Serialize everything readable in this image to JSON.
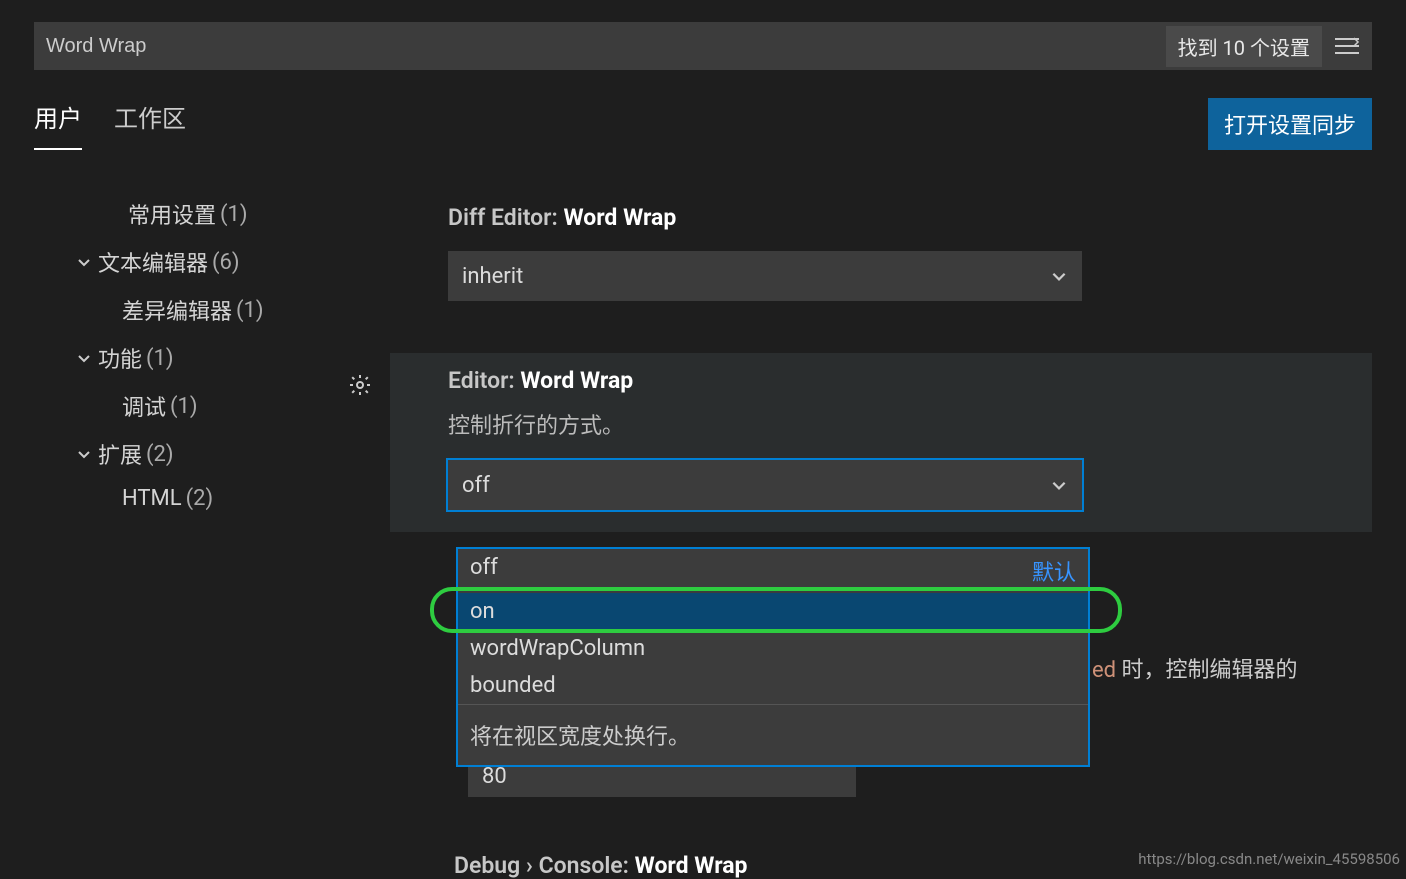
{
  "search": {
    "value": "Word Wrap",
    "result_count": "找到 10 个设置"
  },
  "tabs": {
    "user": "用户",
    "workspace": "工作区"
  },
  "sync_button": "打开设置同步",
  "sidebar": {
    "common": {
      "label": "常用设置",
      "count": "(1)"
    },
    "text_editor": {
      "label": "文本编辑器",
      "count": "(6)"
    },
    "diff_editor": {
      "label": "差异编辑器",
      "count": "(1)"
    },
    "features": {
      "label": "功能",
      "count": "(1)"
    },
    "debug": {
      "label": "调试",
      "count": "(1)"
    },
    "extensions": {
      "label": "扩展",
      "count": "(2)"
    },
    "html": {
      "label": "HTML",
      "count": "(2)"
    }
  },
  "setting1": {
    "ns": "Diff Editor: ",
    "name": "Word Wrap",
    "value": "inherit"
  },
  "setting2": {
    "ns": "Editor: ",
    "name": "Word Wrap",
    "desc": "控制折行的方式。",
    "value": "off",
    "options": {
      "off": "off",
      "on": "on",
      "wordWrapColumn": "wordWrapColumn",
      "bounded": "bounded"
    },
    "default_tag": "默认",
    "hint": "将在视区宽度处换行。"
  },
  "behind": {
    "suffix": " 时，控制编辑器的",
    "bounded_fragment": "ed",
    "column_value": "80"
  },
  "setting3": {
    "ns": "Debug › Console: ",
    "name": "Word Wrap"
  },
  "watermark": "https://blog.csdn.net/weixin_45598506"
}
